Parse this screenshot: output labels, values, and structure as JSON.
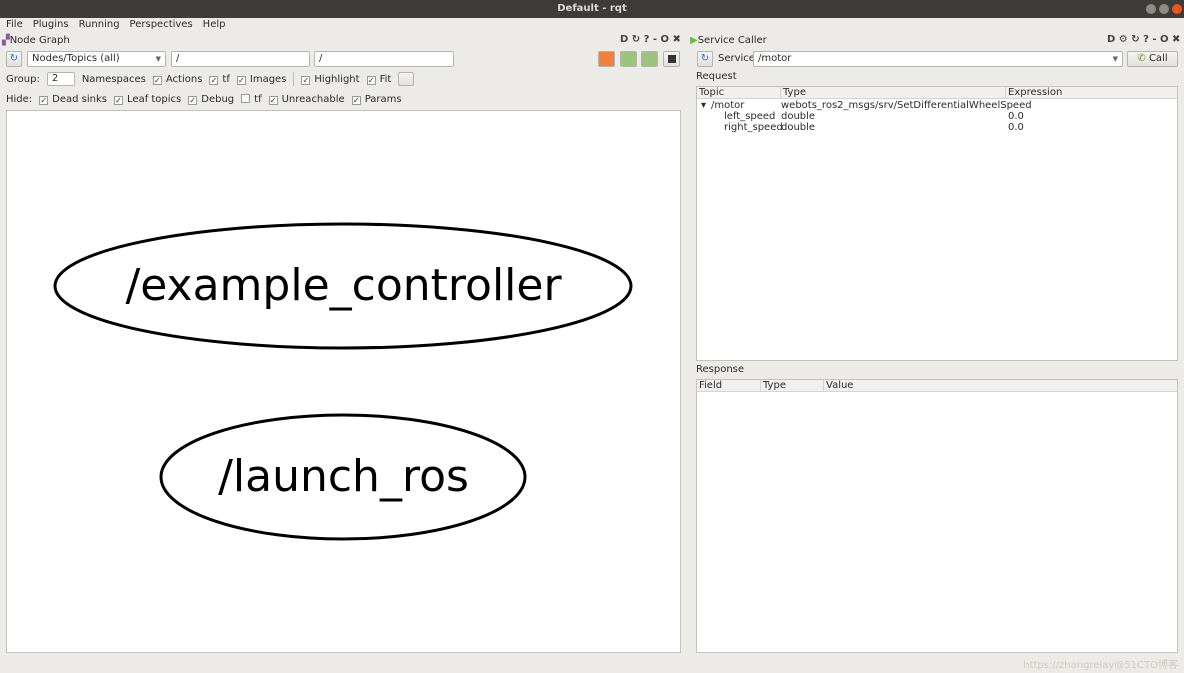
{
  "window": {
    "title": "Default - rqt",
    "watermark": "https://zhangrelay@51CTO博客"
  },
  "menu": [
    "File",
    "Plugins",
    "Running",
    "Perspectives",
    "Help"
  ],
  "node_graph": {
    "title": "Node Graph",
    "controls": "D ↻ ? - O ✖",
    "mode": "Nodes/Topics (all)",
    "filter1": "/",
    "filter2": "/",
    "group_label": "Group:",
    "group_value": "2",
    "options": [
      {
        "label": "Namespaces",
        "checked": null
      },
      {
        "label": "Actions",
        "checked": true
      },
      {
        "label": "tf",
        "checked": true
      },
      {
        "label": "Images",
        "checked": true
      },
      {
        "label": "Highlight",
        "checked": true
      },
      {
        "label": "Fit",
        "checked": true
      }
    ],
    "hide_label": "Hide:",
    "hide": [
      {
        "label": "Dead sinks",
        "checked": true
      },
      {
        "label": "Leaf topics",
        "checked": true
      },
      {
        "label": "Debug",
        "checked": true
      },
      {
        "label": "tf",
        "checked": false
      },
      {
        "label": "Unreachable",
        "checked": true
      },
      {
        "label": "Params",
        "checked": true
      }
    ],
    "nodes": [
      "/example_controller",
      "/launch_ros"
    ]
  },
  "service_caller": {
    "title": "Service Caller",
    "controls": "D ⚙ ↻ ? - O ✖",
    "service_label": "Service",
    "service_value": "/motor",
    "call_label": "Call",
    "request_label": "Request",
    "request_columns": [
      "Topic",
      "Type",
      "Expression"
    ],
    "request_rows": [
      {
        "topic": "/motor",
        "type": "webots_ros2_msgs/srv/SetDifferentialWheelSpeed",
        "expr": ""
      },
      {
        "topic": "left_speed",
        "type": "double",
        "expr": "0.0"
      },
      {
        "topic": "right_speed",
        "type": "double",
        "expr": "0.0"
      }
    ],
    "response_label": "Response",
    "response_columns": [
      "Field",
      "Type",
      "Value"
    ]
  }
}
